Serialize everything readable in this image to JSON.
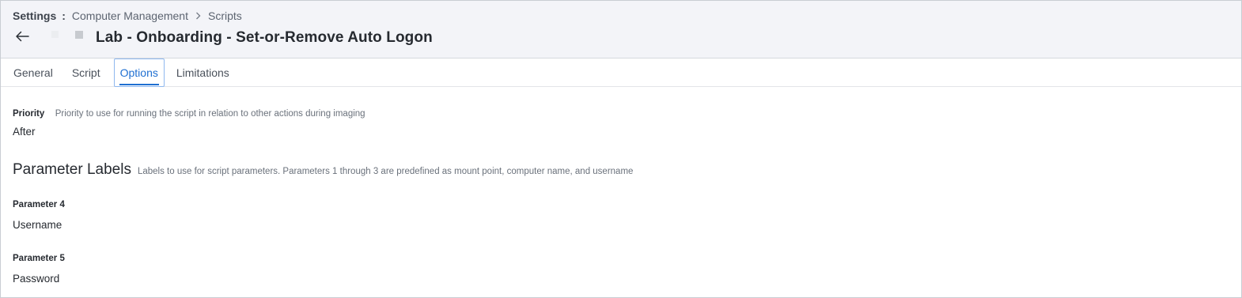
{
  "breadcrumb": {
    "root": "Settings",
    "separator": ":",
    "items": [
      "Computer Management",
      "Scripts"
    ]
  },
  "header": {
    "title": "Lab - Onboarding - Set-or-Remove Auto Logon"
  },
  "tabs": [
    {
      "label": "General",
      "active": false
    },
    {
      "label": "Script",
      "active": false
    },
    {
      "label": "Options",
      "active": true
    },
    {
      "label": "Limitations",
      "active": false
    }
  ],
  "options": {
    "priority": {
      "label": "Priority",
      "help": "Priority to use for running the script in relation to other actions during imaging",
      "value": "After"
    },
    "parameter_labels": {
      "title": "Parameter Labels",
      "help": "Labels to use for script parameters. Parameters 1 through 3 are predefined as mount point, computer name, and username"
    },
    "parameters": [
      {
        "label": "Parameter 4",
        "value": "Username"
      },
      {
        "label": "Parameter 5",
        "value": "Password"
      }
    ]
  },
  "colors": {
    "accent": "#1f6fd1",
    "header_bg": "#f3f4f8"
  }
}
